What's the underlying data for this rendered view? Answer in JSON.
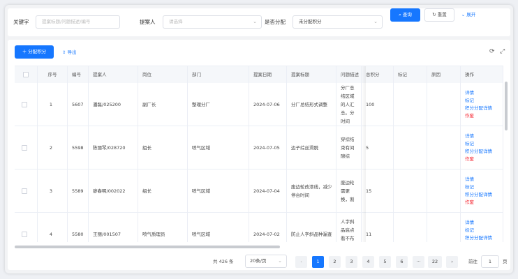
{
  "filters": {
    "keyword_label": "关键字",
    "keyword_placeholder": "提案标题/问题描述/编号",
    "proposer_label": "提案人",
    "proposer_placeholder": "请选择",
    "allocated_label": "是否分配",
    "allocated_value": "未分配积分",
    "search_button": "查询",
    "reset_button": "重置",
    "expand_link": "展开"
  },
  "toolbar": {
    "allocate_button": "分配积分",
    "export_link": "导出"
  },
  "table": {
    "columns": [
      "序号",
      "编号",
      "提案人",
      "岗位",
      "部门",
      "提案日期",
      "提案标题",
      "问题描述",
      "总积分",
      "标记",
      "原因",
      "操作"
    ],
    "rows": [
      {
        "index": "1",
        "code": "5607",
        "proposer": "潘磊/025200",
        "position": "副厂长",
        "department": "整理分厂",
        "date": "2024-07-06",
        "title": "分厂总结形式调整",
        "description": "分厂总结区域的人汇总。分时间",
        "score": "100"
      },
      {
        "index": "2",
        "code": "5598",
        "proposer": "陈丽琴/028720",
        "position": "组长",
        "department": "喷气区域",
        "date": "2024-07-05",
        "title": "边子综丝滑脱",
        "description": "穿综结束有间隙综",
        "score": "5"
      },
      {
        "index": "3",
        "code": "5589",
        "proposer": "廖春明/002022",
        "position": "组长",
        "department": "喷气区域",
        "date": "2024-07-04",
        "title": "废边轮改漆线，减少停台时间",
        "description": "废边轮需更换，割",
        "score": "15"
      },
      {
        "index": "4",
        "code": "5580",
        "proposer": "王丽/001507",
        "position": "喷气质理员",
        "department": "喷气区域",
        "date": "2024-07-02",
        "title": "防止人字斜品种漏查",
        "description": "人字斜品底点看不布彩响质",
        "score": "11"
      }
    ],
    "actions": {
      "detail": "详情",
      "mark": "标记",
      "allocation_detail": "积分分配详情",
      "void": "作废"
    }
  },
  "pagination": {
    "total_text": "共 426 条",
    "page_size": "20条/页",
    "pages": [
      "1",
      "2",
      "3",
      "4",
      "5",
      "6"
    ],
    "ellipsis": "···",
    "last_page": "22",
    "goto_label": "前往",
    "goto_value": "1",
    "page_suffix": "页"
  },
  "colors": {
    "primary": "#1677ff",
    "danger": "#f5222d"
  }
}
